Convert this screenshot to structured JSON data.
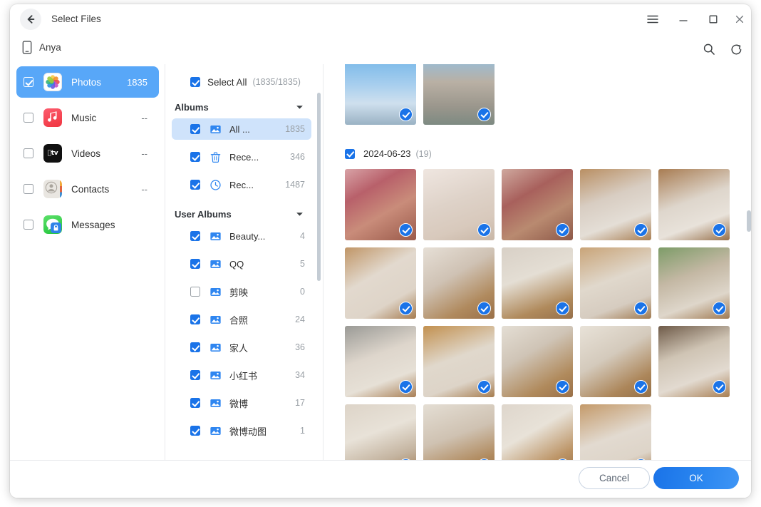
{
  "window": {
    "title": "Select Files",
    "back_icon": "arrow-left-icon",
    "menu_icon": "hamburger-menu-icon",
    "minimize_icon": "minimize-icon",
    "maximize_icon": "maximize-icon",
    "close_icon": "close-icon"
  },
  "device": {
    "name": "Anya",
    "icon": "phone-icon",
    "search_icon": "search-icon",
    "refresh_icon": "refresh-icon"
  },
  "sidebar": {
    "items": [
      {
        "label": "Photos",
        "count": "1835",
        "icon": "photos-app-icon",
        "checked": true,
        "selected": true
      },
      {
        "label": "Music",
        "count": "--",
        "icon": "music-app-icon",
        "checked": false,
        "selected": false
      },
      {
        "label": "Videos",
        "count": "--",
        "icon": "appletv-app-icon",
        "checked": false,
        "selected": false
      },
      {
        "label": "Contacts",
        "count": "--",
        "icon": "contacts-app-icon",
        "checked": false,
        "selected": false
      },
      {
        "label": "Messages",
        "count": "",
        "icon": "messages-app-icon",
        "checked": false,
        "selected": false
      }
    ]
  },
  "albums_panel": {
    "select_all": {
      "label": "Select All",
      "count": "(1835/1835)",
      "checked": true
    },
    "groups": [
      {
        "title": "Albums",
        "caret": "chevron-down-icon",
        "items": [
          {
            "label": "All ...",
            "count": "1835",
            "icon": "image-icon",
            "checked": true,
            "selected": true
          },
          {
            "label": "Rece...",
            "count": "346",
            "icon": "trash-icon",
            "checked": true,
            "selected": false
          },
          {
            "label": "Rec...",
            "count": "1487",
            "icon": "clock-icon",
            "checked": true,
            "selected": false
          }
        ]
      },
      {
        "title": "User Albums",
        "caret": "chevron-down-icon",
        "items": [
          {
            "label": "Beauty...",
            "count": "4",
            "icon": "image-icon",
            "checked": true,
            "selected": false
          },
          {
            "label": "QQ",
            "count": "5",
            "icon": "image-icon",
            "checked": true,
            "selected": false
          },
          {
            "label": "剪映",
            "count": "0",
            "icon": "image-icon",
            "checked": false,
            "selected": false
          },
          {
            "label": "合照",
            "count": "24",
            "icon": "image-icon",
            "checked": true,
            "selected": false
          },
          {
            "label": "家人",
            "count": "36",
            "icon": "image-icon",
            "checked": true,
            "selected": false
          },
          {
            "label": "小红书",
            "count": "34",
            "icon": "image-icon",
            "checked": true,
            "selected": false
          },
          {
            "label": "微博",
            "count": "17",
            "icon": "image-icon",
            "checked": true,
            "selected": false
          },
          {
            "label": "微博动图",
            "count": "1",
            "icon": "image-icon",
            "checked": true,
            "selected": false
          }
        ]
      }
    ]
  },
  "photos_panel": {
    "date_group": {
      "label": "2024-06-23",
      "count": "(19)",
      "checked": true
    },
    "top_row": [
      {
        "name": "sky-clouds-streetlamp",
        "selected": true
      },
      {
        "name": "city-buildings-sticker",
        "selected": true
      }
    ],
    "grid": [
      {
        "name": "food-tray-watermelon",
        "selected": true
      },
      {
        "name": "paper-cups-toast",
        "selected": true
      },
      {
        "name": "food-tray-salad",
        "selected": true
      },
      {
        "name": "cat-sitting-floor",
        "selected": true
      },
      {
        "name": "cat-lying-back",
        "selected": true
      },
      {
        "name": "cat-stretched-floor",
        "selected": true
      },
      {
        "name": "cat-face-closeup",
        "selected": true
      },
      {
        "name": "cat-on-wood-floor",
        "selected": true
      },
      {
        "name": "cat-kitchen-cabinet",
        "selected": true
      },
      {
        "name": "cat-near-plant",
        "selected": true
      },
      {
        "name": "cat-being-petted",
        "selected": true
      },
      {
        "name": "cat-paw-forward",
        "selected": true
      },
      {
        "name": "cat-rolling-floor",
        "selected": true
      },
      {
        "name": "cat-lying-side",
        "selected": true
      },
      {
        "name": "cat-looking-up",
        "selected": true
      },
      {
        "name": "cat-tail-up",
        "selected": true
      },
      {
        "name": "cat-head-tilt",
        "selected": true
      },
      {
        "name": "cat-blue-eyes",
        "selected": true
      },
      {
        "name": "cat-whiskers-floor",
        "selected": true
      }
    ]
  },
  "footer": {
    "cancel_label": "Cancel",
    "ok_label": "OK"
  },
  "colors": {
    "accent": "#1a73e8",
    "selected_row": "#58a7f8",
    "album_selected": "#cfe3fb",
    "muted_text": "#9aa0a6"
  }
}
